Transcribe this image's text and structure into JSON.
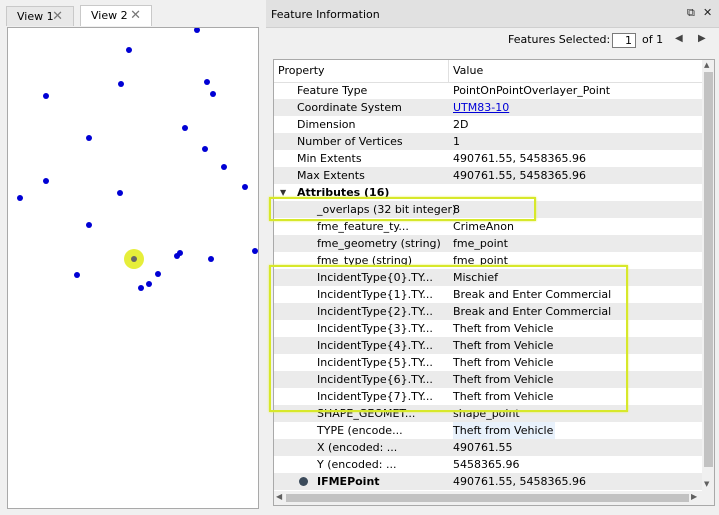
{
  "tabs": [
    {
      "label": "View 1",
      "close": "✕"
    },
    {
      "label": "View 2",
      "close": "✕"
    }
  ],
  "panel": {
    "title": "Feature Information",
    "float_btn": "⧉",
    "close_btn": "✕"
  },
  "selection": {
    "label": "Features Selected:",
    "current": "1",
    "of_label": "of 1"
  },
  "table": {
    "col_property": "Property",
    "col_value": "Value",
    "rows": [
      {
        "property": "Feature Type",
        "value": "PointOnPointOverlayer_Point"
      },
      {
        "property": "Coordinate System",
        "value": "UTM83-10"
      },
      {
        "property": "Dimension",
        "value": "2D"
      },
      {
        "property": "Number of Vertices",
        "value": "1"
      },
      {
        "property": "Min Extents",
        "value": "490761.55, 5458365.96"
      },
      {
        "property": "Max Extents",
        "value": "490761.55, 5458365.96"
      },
      {
        "property": "Attributes (16)",
        "value": ""
      },
      {
        "property": "_overlaps (32 bit integer)",
        "value": "8"
      },
      {
        "property": "fme_feature_ty...",
        "value": "CrimeAnon"
      },
      {
        "property": "fme_geometry (string)",
        "value": "fme_point"
      },
      {
        "property": "fme_type (string)",
        "value": "fme_point"
      },
      {
        "property": "IncidentType{0}.TY...",
        "value": "Mischief"
      },
      {
        "property": "IncidentType{1}.TY...",
        "value": "Break and Enter Commercial"
      },
      {
        "property": "IncidentType{2}.TY...",
        "value": "Break and Enter Commercial"
      },
      {
        "property": "IncidentType{3}.TY...",
        "value": "Theft from Vehicle"
      },
      {
        "property": "IncidentType{4}.TY...",
        "value": "Theft from Vehicle"
      },
      {
        "property": "IncidentType{5}.TY...",
        "value": "Theft from Vehicle"
      },
      {
        "property": "IncidentType{6}.TY...",
        "value": "Theft from Vehicle"
      },
      {
        "property": "IncidentType{7}.TY...",
        "value": "Theft from Vehicle"
      },
      {
        "property": "SHAPE_GEOMET...",
        "value": "shape_point"
      },
      {
        "property": "TYPE (encode...",
        "value": "Theft from Vehicle"
      },
      {
        "property": "X (encoded: ...",
        "value": "490761.55"
      },
      {
        "property": "Y (encoded: ...",
        "value": "5458365.96"
      },
      {
        "property": "IFMEPoint",
        "value": "490761.55, 5458365.96"
      }
    ]
  },
  "colors": {
    "point": "#0000d4",
    "selected_halo": "#e6ee3a",
    "highlight_box": "#d7e82a",
    "link": "#0000d8"
  }
}
